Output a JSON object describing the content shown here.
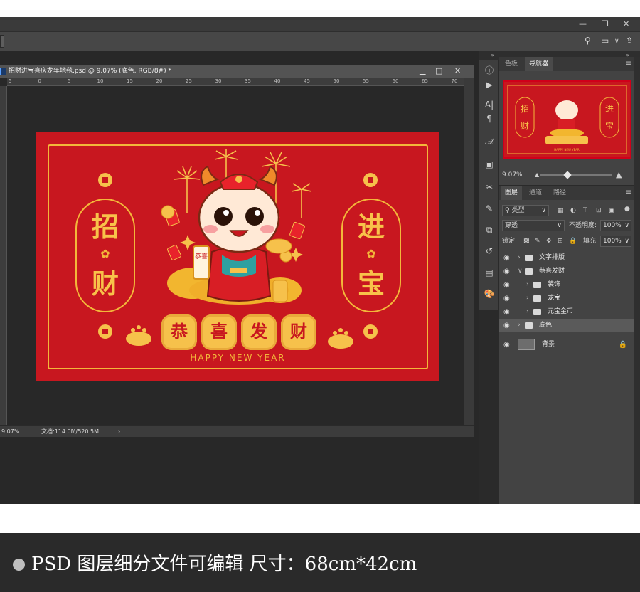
{
  "document": {
    "tab_title": "招财进宝喜庆龙年地毯.psd @ 9.07% (底色, RGB/8#) *",
    "ruler_ticks": [
      "5",
      "0",
      "5",
      "10",
      "15",
      "20",
      "25",
      "30",
      "35",
      "40",
      "45",
      "50",
      "55",
      "60",
      "65",
      "70"
    ],
    "zoom": "9.07%",
    "doc_info": "文档:114.0M/520.5M",
    "status_arrow": "›"
  },
  "artwork": {
    "left_chars": [
      "招",
      "财"
    ],
    "right_chars": [
      "进",
      "宝"
    ],
    "blessing": [
      "恭",
      "喜",
      "发",
      "财"
    ],
    "scroll_text": "恭喜",
    "subtitle": "HAPPY NEW YEAR",
    "colors": {
      "red": "#c8171f",
      "gold": "#f6c14b"
    }
  },
  "panels": {
    "top_tabs": [
      {
        "label": "色板",
        "active": false
      },
      {
        "label": "导航器",
        "active": true
      }
    ],
    "nav_zoom": "9.07%",
    "layer_tabs": [
      {
        "label": "图层",
        "active": true
      },
      {
        "label": "通道",
        "active": false
      },
      {
        "label": "路径",
        "active": false
      }
    ],
    "filter_kind": "类型",
    "blend_mode": "穿透",
    "opacity_label": "不透明度:",
    "opacity_value": "100%",
    "lock_label": "锁定:",
    "fill_label": "填充:",
    "fill_value": "100%",
    "layers": [
      {
        "name": "文字排版",
        "indent": 0,
        "expanded": false,
        "type": "folder",
        "selected": false
      },
      {
        "name": "恭喜发财",
        "indent": 0,
        "expanded": true,
        "type": "folder",
        "selected": false
      },
      {
        "name": "装饰",
        "indent": 1,
        "expanded": false,
        "type": "folder",
        "selected": false
      },
      {
        "name": "龙宝",
        "indent": 1,
        "expanded": false,
        "type": "folder",
        "selected": false
      },
      {
        "name": "元宝金币",
        "indent": 1,
        "expanded": false,
        "type": "folder",
        "selected": false
      },
      {
        "name": "底色",
        "indent": 0,
        "expanded": false,
        "type": "folder",
        "selected": true
      },
      {
        "name": "背景",
        "indent": 0,
        "expanded": false,
        "type": "background",
        "selected": false
      }
    ]
  },
  "footer": {
    "text": "PSD 图层细分文件可编辑   尺寸：68cm*42cm"
  }
}
